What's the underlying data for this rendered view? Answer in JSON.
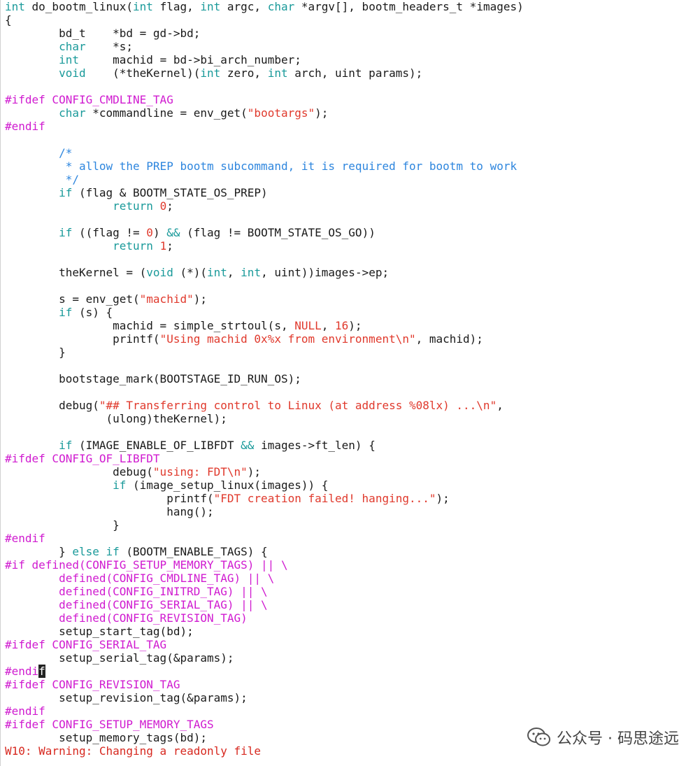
{
  "code_lines": [
    [
      [
        "kw",
        "int"
      ],
      [
        "",
        "do_bootm_linux("
      ],
      [
        "kw",
        "int"
      ],
      [
        "",
        "flag, "
      ],
      [
        "kw",
        "int"
      ],
      [
        "",
        "argc, "
      ],
      [
        "kw",
        "char"
      ],
      [
        "",
        "*argv[], bootm_headers_t *images)"
      ]
    ],
    [
      [
        "",
        "{"
      ]
    ],
    [
      [
        "",
        "        bd_t    *bd = gd->bd;"
      ]
    ],
    [
      [
        "",
        "        "
      ],
      [
        "kw",
        "char"
      ],
      [
        "",
        "    *s;"
      ]
    ],
    [
      [
        "",
        "        "
      ],
      [
        "kw",
        "int"
      ],
      [
        "",
        "     machid = bd->bi_arch_number;"
      ]
    ],
    [
      [
        "",
        "        "
      ],
      [
        "kw",
        "void"
      ],
      [
        "",
        "    (*theKernel)("
      ],
      [
        "kw",
        "int"
      ],
      [
        "",
        "zero, "
      ],
      [
        "kw",
        "int"
      ],
      [
        "",
        "arch, uint params);"
      ]
    ],
    [],
    [
      [
        "pp",
        "#ifdef CONFIG_CMDLINE_TAG"
      ]
    ],
    [
      [
        "",
        "        "
      ],
      [
        "kw",
        "char"
      ],
      [
        "",
        "*commandline = env_get("
      ],
      [
        "str",
        "\"bootargs\""
      ],
      [
        "",
        ");"
      ]
    ],
    [
      [
        "pp",
        "#endif"
      ]
    ],
    [],
    [
      [
        "cm",
        "        /*"
      ]
    ],
    [
      [
        "cm",
        "         * allow the PREP bootm subcommand, it is required for bootm to work"
      ]
    ],
    [
      [
        "cm",
        "         */"
      ]
    ],
    [
      [
        "",
        "        "
      ],
      [
        "kw",
        "if"
      ],
      [
        "",
        "(flag & BOOTM_STATE_OS_PREP)"
      ]
    ],
    [
      [
        "",
        "                "
      ],
      [
        "kw",
        "return"
      ],
      [
        "",
        " "
      ],
      [
        "num",
        "0"
      ],
      [
        "",
        ";"
      ]
    ],
    [],
    [
      [
        "",
        "        "
      ],
      [
        "kw",
        "if"
      ],
      [
        "",
        "((flag != "
      ],
      [
        "num",
        "0"
      ],
      [
        "",
        ") "
      ],
      [
        "kw",
        "&&"
      ],
      [
        "",
        "(flag != BOOTM_STATE_OS_GO))"
      ]
    ],
    [
      [
        "",
        "                "
      ],
      [
        "kw",
        "return"
      ],
      [
        "",
        " "
      ],
      [
        "num",
        "1"
      ],
      [
        "",
        ";"
      ]
    ],
    [],
    [
      [
        "",
        "        theKernel = ("
      ],
      [
        "kw",
        "void"
      ],
      [
        "",
        "(*)("
      ],
      [
        "kw",
        "int"
      ],
      [
        "",
        ", "
      ],
      [
        "kw",
        "int"
      ],
      [
        "",
        ", uint))images->ep;"
      ]
    ],
    [],
    [
      [
        "",
        "        s = env_get("
      ],
      [
        "str",
        "\"machid\""
      ],
      [
        "",
        ");"
      ]
    ],
    [
      [
        "",
        "        "
      ],
      [
        "kw",
        "if"
      ],
      [
        "",
        "(s) {"
      ]
    ],
    [
      [
        "",
        "                machid = simple_strtoul(s, "
      ],
      [
        "num",
        "NULL"
      ],
      [
        "",
        ", "
      ],
      [
        "num",
        "16"
      ],
      [
        "",
        ");"
      ]
    ],
    [
      [
        "",
        "                printf("
      ],
      [
        "str",
        "\"Using machid 0x%x from environment\\n\""
      ],
      [
        "",
        ", machid);"
      ]
    ],
    [
      [
        "",
        "        }"
      ]
    ],
    [],
    [
      [
        "",
        "        bootstage_mark(BOOTSTAGE_ID_RUN_OS);"
      ]
    ],
    [],
    [
      [
        "",
        "        debug("
      ],
      [
        "str",
        "\"## Transferring control to Linux (at address %08lx) ...\\n\""
      ],
      [
        "",
        ","
      ]
    ],
    [
      [
        "",
        "               (ulong)theKernel);"
      ]
    ],
    [],
    [
      [
        "",
        "        "
      ],
      [
        "kw",
        "if"
      ],
      [
        "",
        "(IMAGE_ENABLE_OF_LIBFDT "
      ],
      [
        "kw",
        "&&"
      ],
      [
        "",
        "images->ft_len) {"
      ]
    ],
    [
      [
        "pp",
        "#ifdef CONFIG_OF_LIBFDT"
      ]
    ],
    [
      [
        "",
        "                debug("
      ],
      [
        "str",
        "\"using: FDT\\n\""
      ],
      [
        "",
        ");"
      ]
    ],
    [
      [
        "",
        "                "
      ],
      [
        "kw",
        "if"
      ],
      [
        "",
        "(image_setup_linux(images)) {"
      ]
    ],
    [
      [
        "",
        "                        printf("
      ],
      [
        "str",
        "\"FDT creation failed! hanging...\""
      ],
      [
        "",
        ");"
      ]
    ],
    [
      [
        "",
        "                        hang();"
      ]
    ],
    [
      [
        "",
        "                }"
      ]
    ],
    [
      [
        "pp",
        "#endif"
      ]
    ],
    [
      [
        "",
        "        } "
      ],
      [
        "kw",
        "else if"
      ],
      [
        "",
        "(BOOTM_ENABLE_TAGS) {"
      ]
    ],
    [
      [
        "pp",
        "#if defined(CONFIG_SETUP_MEMORY_TAGS) || \\"
      ]
    ],
    [
      [
        "pp",
        "        defined(CONFIG_CMDLINE_TAG) || \\"
      ]
    ],
    [
      [
        "pp",
        "        defined(CONFIG_INITRD_TAG) || \\"
      ]
    ],
    [
      [
        "pp",
        "        defined(CONFIG_SERIAL_TAG) || \\"
      ]
    ],
    [
      [
        "pp",
        "        defined(CONFIG_REVISION_TAG)"
      ]
    ],
    [
      [
        "",
        "        setup_start_tag(bd);"
      ]
    ],
    [
      [
        "pp",
        "#ifdef CONFIG_SERIAL_TAG"
      ]
    ],
    [
      [
        "",
        "        setup_serial_tag(&params);"
      ]
    ],
    [
      [
        "pp",
        "#endi"
      ],
      [
        "cursor",
        "f"
      ]
    ],
    [
      [
        "pp",
        "#ifdef CONFIG_REVISION_TAG"
      ]
    ],
    [
      [
        "",
        "        setup_revision_tag(&params);"
      ]
    ],
    [
      [
        "pp",
        "#endif"
      ]
    ],
    [
      [
        "pp",
        "#ifdef CONFIG_SETUP_MEMORY_TAGS"
      ]
    ],
    [
      [
        "",
        "        setup_memory_tags(bd);"
      ]
    ],
    [
      [
        "warn",
        "W10: Warning: Changing a readonly file"
      ]
    ]
  ],
  "watermark": {
    "text": "公众号 · 码思途远",
    "icon": "wechat-icon"
  },
  "colors": {
    "keyword": "#1a9a9a",
    "preprocessor": "#d01bd0",
    "string": "#e0392c",
    "comment": "#2e86de",
    "warning": "#d7281f"
  }
}
